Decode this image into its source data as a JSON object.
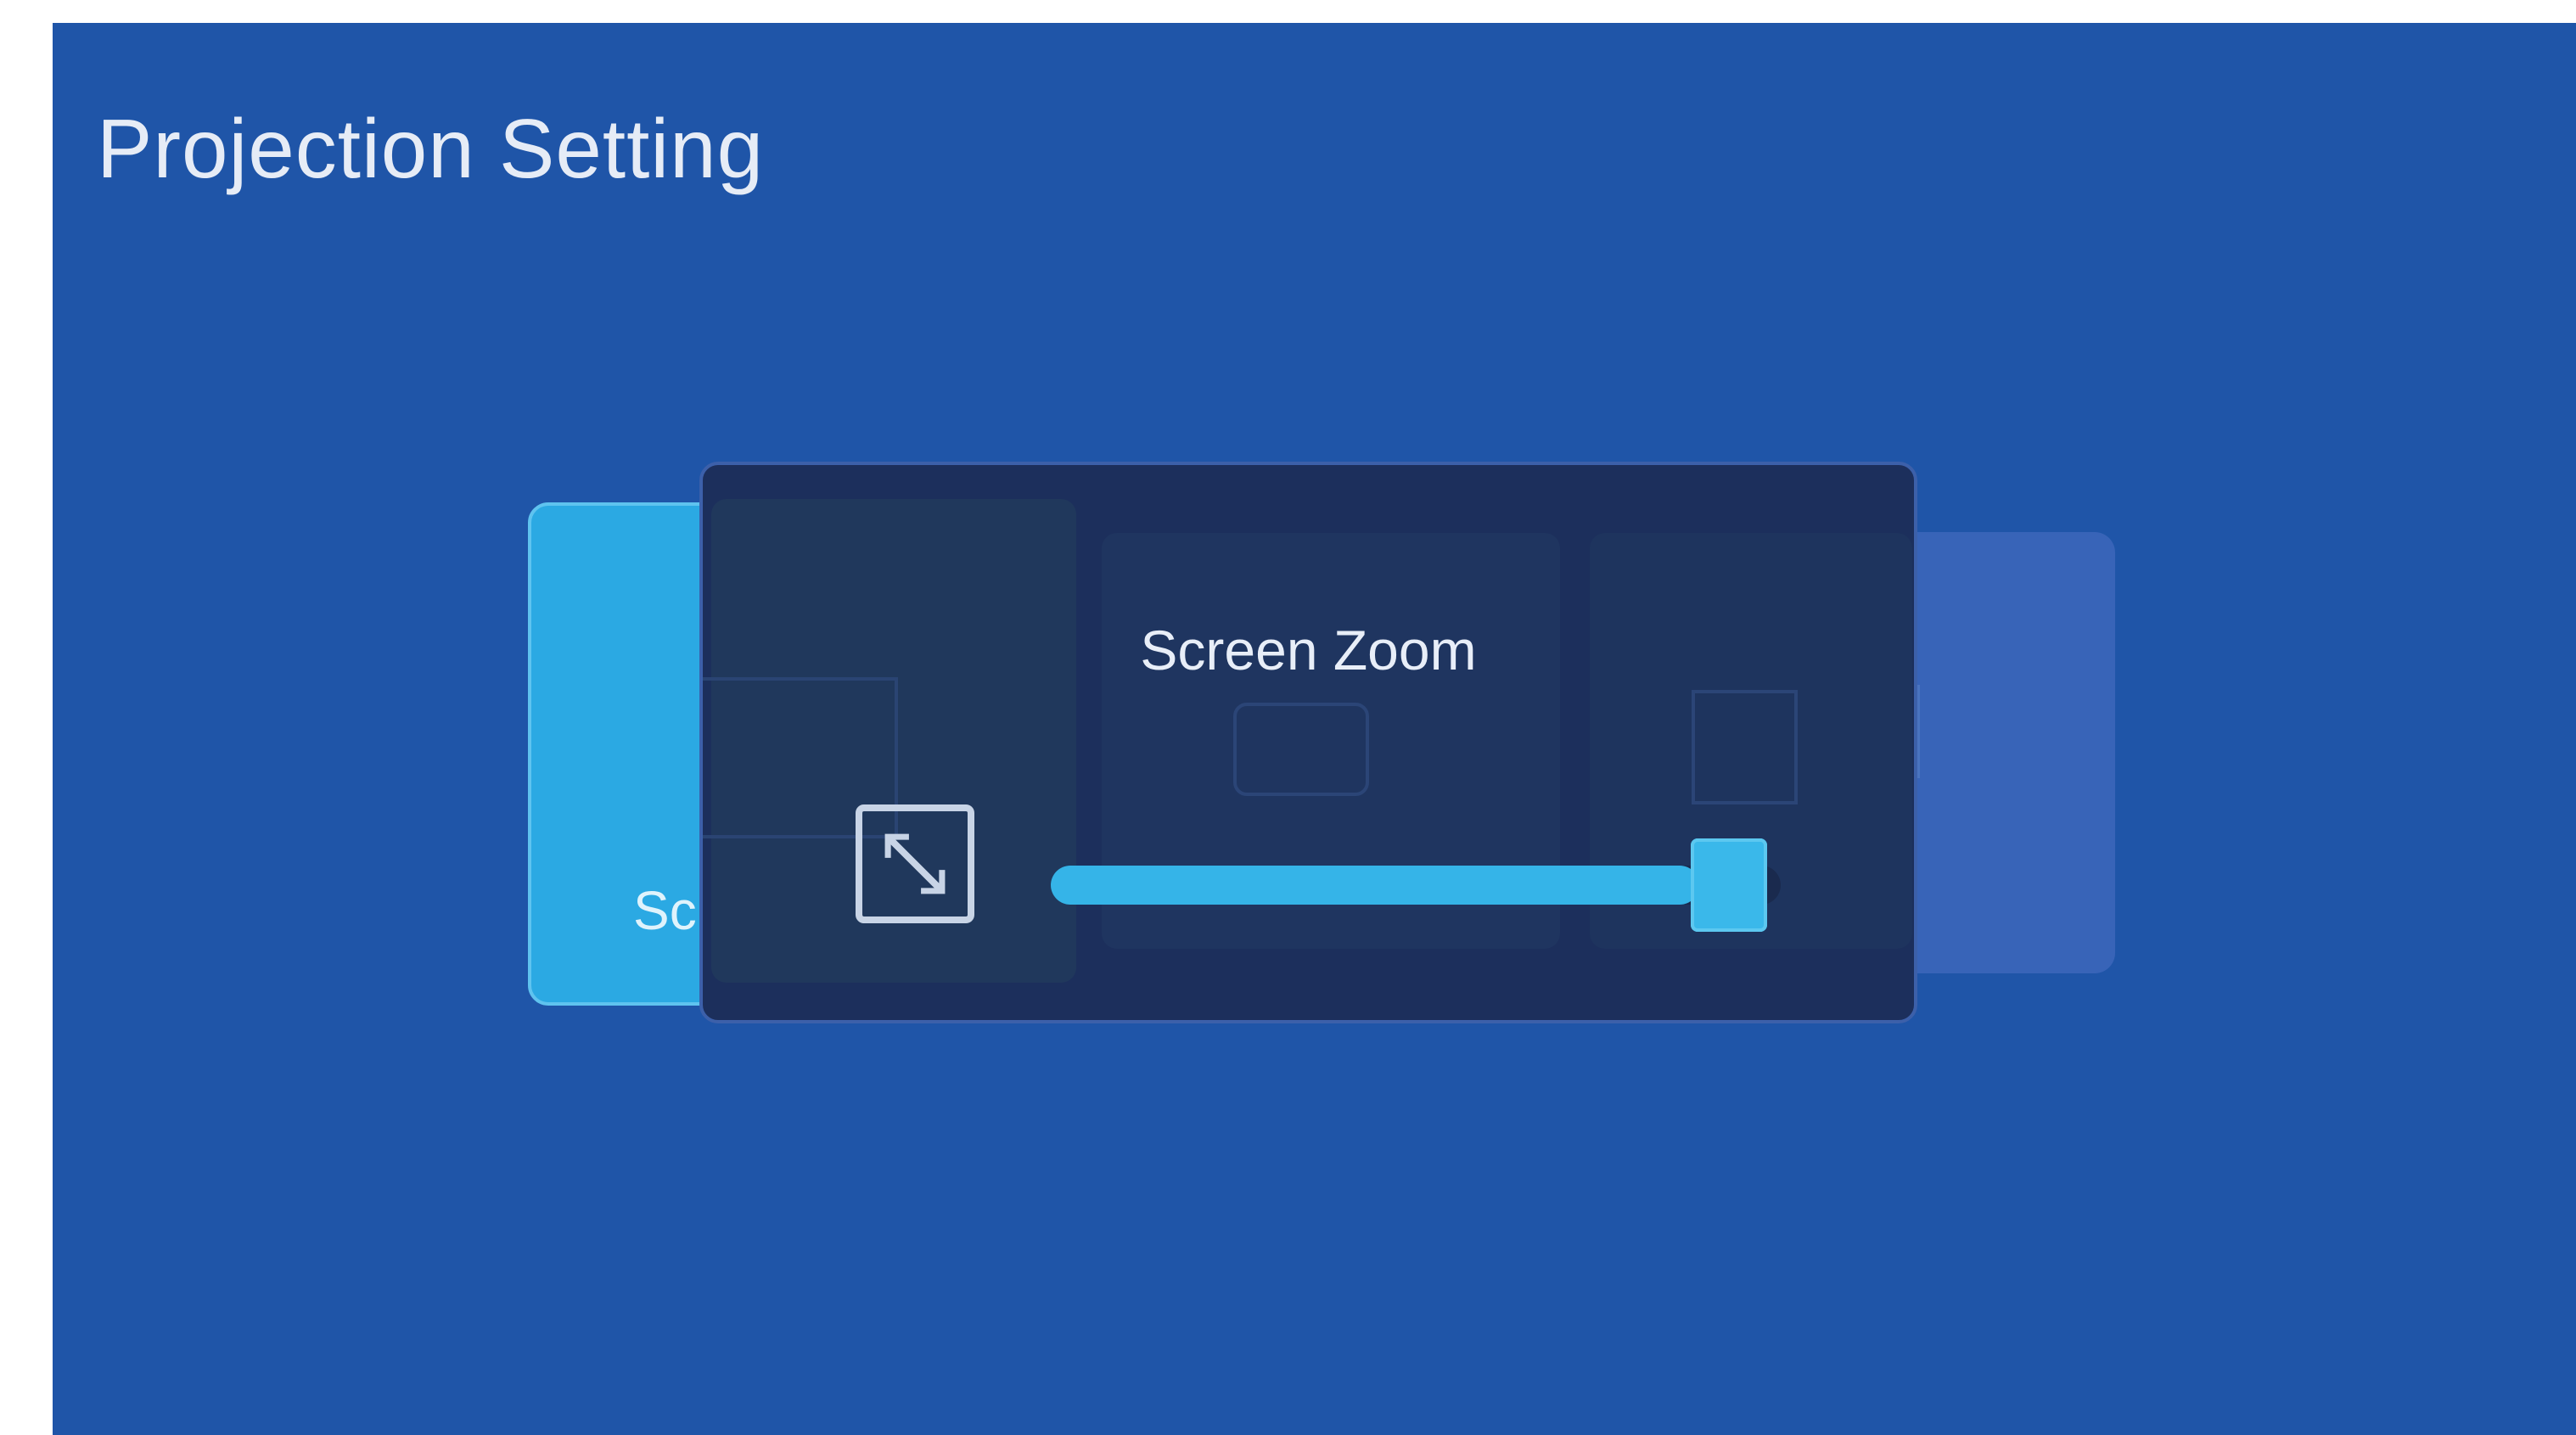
{
  "page": {
    "title": "Projection Setting"
  },
  "menu": {
    "left_card_label": "Sc"
  },
  "dialog": {
    "title": "Screen Zoom",
    "zoom_icon": "resize-diagonal-icon",
    "slider": {
      "value_fraction": 0.98,
      "fill_color": "#35b4e8"
    }
  },
  "colors": {
    "background": "#1f55a8",
    "dialog_background": "#1c2f5c",
    "accent": "#2ba9e3"
  }
}
